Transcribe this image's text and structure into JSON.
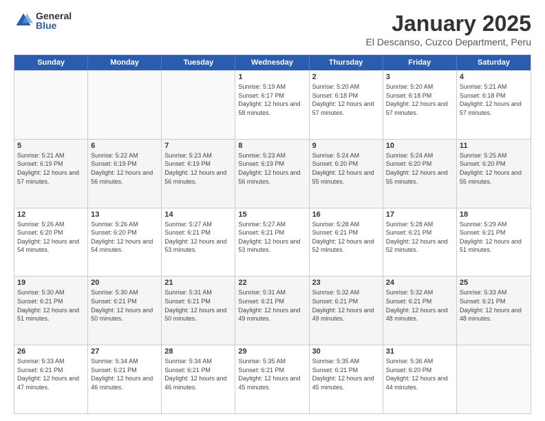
{
  "logo": {
    "general": "General",
    "blue": "Blue"
  },
  "title": "January 2025",
  "subtitle": "El Descanso, Cuzco Department, Peru",
  "days_of_week": [
    "Sunday",
    "Monday",
    "Tuesday",
    "Wednesday",
    "Thursday",
    "Friday",
    "Saturday"
  ],
  "weeks": [
    [
      {
        "day": "",
        "sunrise": "",
        "sunset": "",
        "daylight": ""
      },
      {
        "day": "",
        "sunrise": "",
        "sunset": "",
        "daylight": ""
      },
      {
        "day": "",
        "sunrise": "",
        "sunset": "",
        "daylight": ""
      },
      {
        "day": "1",
        "sunrise": "5:19 AM",
        "sunset": "6:17 PM",
        "daylight": "12 hours and 58 minutes."
      },
      {
        "day": "2",
        "sunrise": "5:20 AM",
        "sunset": "6:18 PM",
        "daylight": "12 hours and 57 minutes."
      },
      {
        "day": "3",
        "sunrise": "5:20 AM",
        "sunset": "6:18 PM",
        "daylight": "12 hours and 57 minutes."
      },
      {
        "day": "4",
        "sunrise": "5:21 AM",
        "sunset": "6:18 PM",
        "daylight": "12 hours and 57 minutes."
      }
    ],
    [
      {
        "day": "5",
        "sunrise": "5:21 AM",
        "sunset": "6:19 PM",
        "daylight": "12 hours and 57 minutes."
      },
      {
        "day": "6",
        "sunrise": "5:22 AM",
        "sunset": "6:19 PM",
        "daylight": "12 hours and 56 minutes."
      },
      {
        "day": "7",
        "sunrise": "5:23 AM",
        "sunset": "6:19 PM",
        "daylight": "12 hours and 56 minutes."
      },
      {
        "day": "8",
        "sunrise": "5:23 AM",
        "sunset": "6:19 PM",
        "daylight": "12 hours and 56 minutes."
      },
      {
        "day": "9",
        "sunrise": "5:24 AM",
        "sunset": "6:20 PM",
        "daylight": "12 hours and 55 minutes."
      },
      {
        "day": "10",
        "sunrise": "5:24 AM",
        "sunset": "6:20 PM",
        "daylight": "12 hours and 55 minutes."
      },
      {
        "day": "11",
        "sunrise": "5:25 AM",
        "sunset": "6:20 PM",
        "daylight": "12 hours and 55 minutes."
      }
    ],
    [
      {
        "day": "12",
        "sunrise": "5:26 AM",
        "sunset": "6:20 PM",
        "daylight": "12 hours and 54 minutes."
      },
      {
        "day": "13",
        "sunrise": "5:26 AM",
        "sunset": "6:20 PM",
        "daylight": "12 hours and 54 minutes."
      },
      {
        "day": "14",
        "sunrise": "5:27 AM",
        "sunset": "6:21 PM",
        "daylight": "12 hours and 53 minutes."
      },
      {
        "day": "15",
        "sunrise": "5:27 AM",
        "sunset": "6:21 PM",
        "daylight": "12 hours and 53 minutes."
      },
      {
        "day": "16",
        "sunrise": "5:28 AM",
        "sunset": "6:21 PM",
        "daylight": "12 hours and 52 minutes."
      },
      {
        "day": "17",
        "sunrise": "5:28 AM",
        "sunset": "6:21 PM",
        "daylight": "12 hours and 52 minutes."
      },
      {
        "day": "18",
        "sunrise": "5:29 AM",
        "sunset": "6:21 PM",
        "daylight": "12 hours and 51 minutes."
      }
    ],
    [
      {
        "day": "19",
        "sunrise": "5:30 AM",
        "sunset": "6:21 PM",
        "daylight": "12 hours and 51 minutes."
      },
      {
        "day": "20",
        "sunrise": "5:30 AM",
        "sunset": "6:21 PM",
        "daylight": "12 hours and 50 minutes."
      },
      {
        "day": "21",
        "sunrise": "5:31 AM",
        "sunset": "6:21 PM",
        "daylight": "12 hours and 50 minutes."
      },
      {
        "day": "22",
        "sunrise": "5:31 AM",
        "sunset": "6:21 PM",
        "daylight": "12 hours and 49 minutes."
      },
      {
        "day": "23",
        "sunrise": "5:32 AM",
        "sunset": "6:21 PM",
        "daylight": "12 hours and 49 minutes."
      },
      {
        "day": "24",
        "sunrise": "5:32 AM",
        "sunset": "6:21 PM",
        "daylight": "12 hours and 48 minutes."
      },
      {
        "day": "25",
        "sunrise": "5:33 AM",
        "sunset": "6:21 PM",
        "daylight": "12 hours and 48 minutes."
      }
    ],
    [
      {
        "day": "26",
        "sunrise": "5:33 AM",
        "sunset": "6:21 PM",
        "daylight": "12 hours and 47 minutes."
      },
      {
        "day": "27",
        "sunrise": "5:34 AM",
        "sunset": "6:21 PM",
        "daylight": "12 hours and 46 minutes."
      },
      {
        "day": "28",
        "sunrise": "5:34 AM",
        "sunset": "6:21 PM",
        "daylight": "12 hours and 46 minutes."
      },
      {
        "day": "29",
        "sunrise": "5:35 AM",
        "sunset": "6:21 PM",
        "daylight": "12 hours and 45 minutes."
      },
      {
        "day": "30",
        "sunrise": "5:35 AM",
        "sunset": "6:21 PM",
        "daylight": "12 hours and 45 minutes."
      },
      {
        "day": "31",
        "sunrise": "5:36 AM",
        "sunset": "6:20 PM",
        "daylight": "12 hours and 44 minutes."
      },
      {
        "day": "",
        "sunrise": "",
        "sunset": "",
        "daylight": ""
      }
    ]
  ]
}
